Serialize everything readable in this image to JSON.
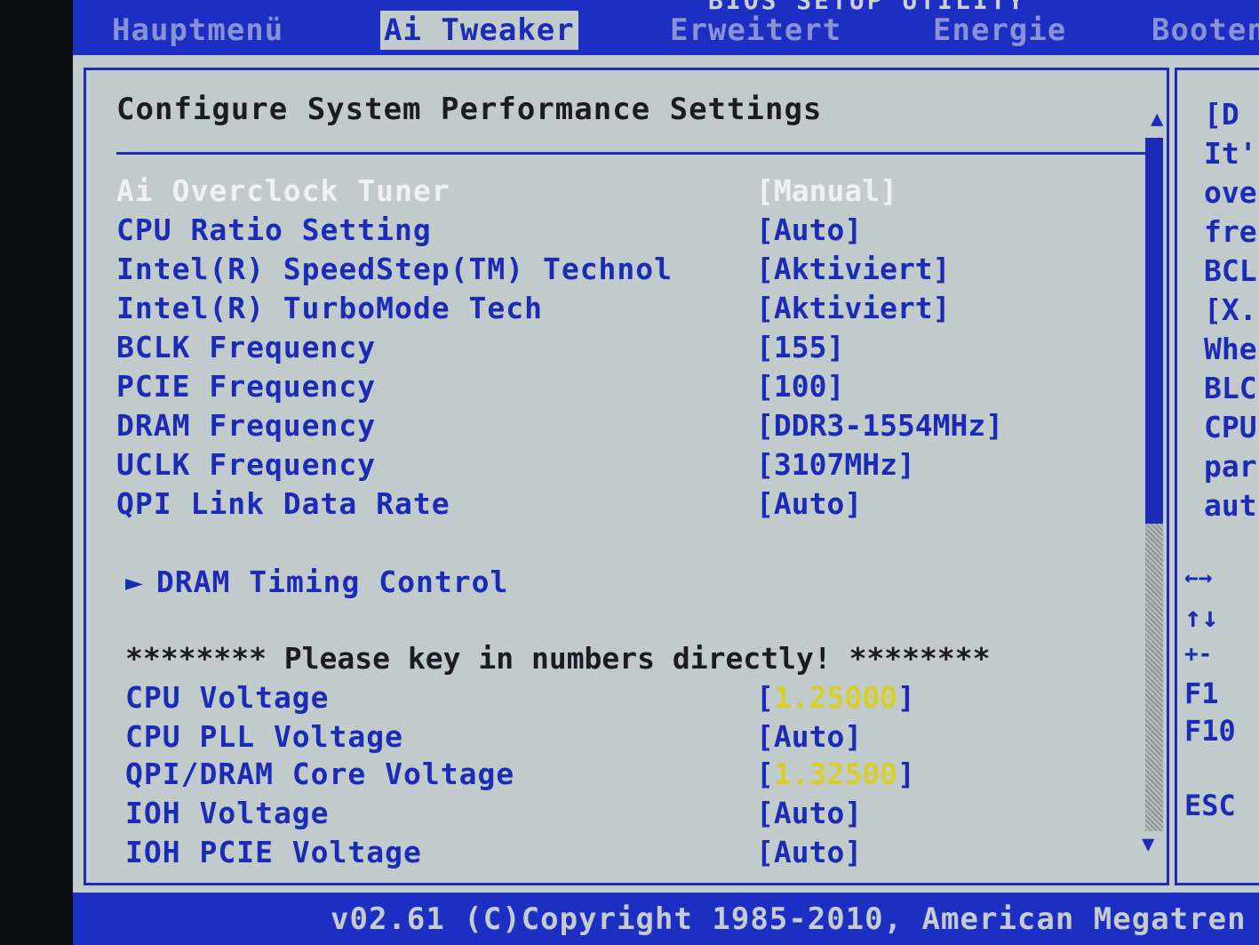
{
  "header": {
    "title": "BIOS SETUP UTILITY",
    "tabs": [
      {
        "label": "Hauptmenü"
      },
      {
        "label": "Ai Tweaker"
      },
      {
        "label": "Erweitert"
      },
      {
        "label": "Energie"
      },
      {
        "label": "Booten"
      }
    ]
  },
  "main": {
    "heading": "Configure System Performance Settings",
    "settings": [
      {
        "label": "Ai Overclock Tuner",
        "value": "[Manual]"
      },
      {
        "label": "CPU Ratio Setting",
        "value": "[Auto]"
      },
      {
        "label": "Intel(R) SpeedStep(TM) Technol",
        "value": "[Aktiviert]"
      },
      {
        "label": "Intel(R) TurboMode Tech",
        "value": "[Aktiviert]"
      },
      {
        "label": "BCLK Frequency",
        "value": "[155]"
      },
      {
        "label": "PCIE Frequency",
        "value": "[100]"
      },
      {
        "label": "DRAM Frequency",
        "value": "[DDR3-1554MHz]"
      },
      {
        "label": "UCLK Frequency",
        "value": "[3107MHz]"
      },
      {
        "label": "QPI Link Data Rate",
        "value": "[Auto]"
      }
    ],
    "submenu": {
      "arrow": "►",
      "label": "DRAM Timing Control"
    },
    "notice": "******** Please key in numbers directly! ********",
    "voltages": [
      {
        "label": "CPU Voltage",
        "open": "[",
        "value": "1.25000",
        "close": "]"
      },
      {
        "label": "CPU PLL Voltage",
        "value": "[Auto]"
      },
      {
        "label": "QPI/DRAM Core Voltage",
        "open": "[",
        "value": "1.32500",
        "close": "]"
      },
      {
        "label": "IOH Voltage",
        "value": "[Auto]"
      },
      {
        "label": "IOH PCIE Voltage",
        "value": "[Auto]"
      }
    ]
  },
  "help": {
    "lines": [
      "[D",
      "It'",
      "ove",
      "fre",
      "BCL",
      "[X.",
      "Whe",
      "BLC",
      "CPU",
      "par",
      "aut"
    ],
    "keys": [
      "←→",
      "↑↓",
      "+-",
      "F1",
      "F10",
      "ESC"
    ]
  },
  "footer": {
    "copyright": "v02.61 (C)Copyright 1985-2010, American Megatren"
  },
  "colors": {
    "background": "#c2cbcb",
    "accent": "#1b2bb6",
    "selected": "#eef2f2",
    "editable_value": "#d7d02c"
  }
}
